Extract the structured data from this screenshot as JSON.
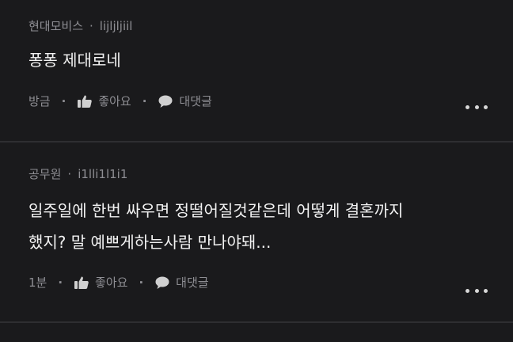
{
  "comments": [
    {
      "author": "현대모비스",
      "user_id": "lijljljiil",
      "text": "퐁퐁 제대로네",
      "time": "방금",
      "like_label": "좋아요",
      "reply_label": "대댓글"
    },
    {
      "author": "공무원",
      "user_id": "i1lli1l1i1",
      "text_lines": [
        "일주일에 한번 싸우면 정떨어질것같은데 어떻게 결혼까지",
        "했지? 말 예쁘게하는사람 만나야돼..."
      ],
      "time": "1분",
      "like_label": "좋아요",
      "reply_label": "대댓글"
    }
  ],
  "separator": "·",
  "icons": {
    "like": "thumbs-up-icon",
    "reply": "speech-bubble-icon",
    "more": "more-dots-icon"
  },
  "colors": {
    "background": "#1a1a1c",
    "meta_text": "#8e8e93",
    "body_text": "#f2f2f2",
    "divider": "#2e2e31"
  }
}
